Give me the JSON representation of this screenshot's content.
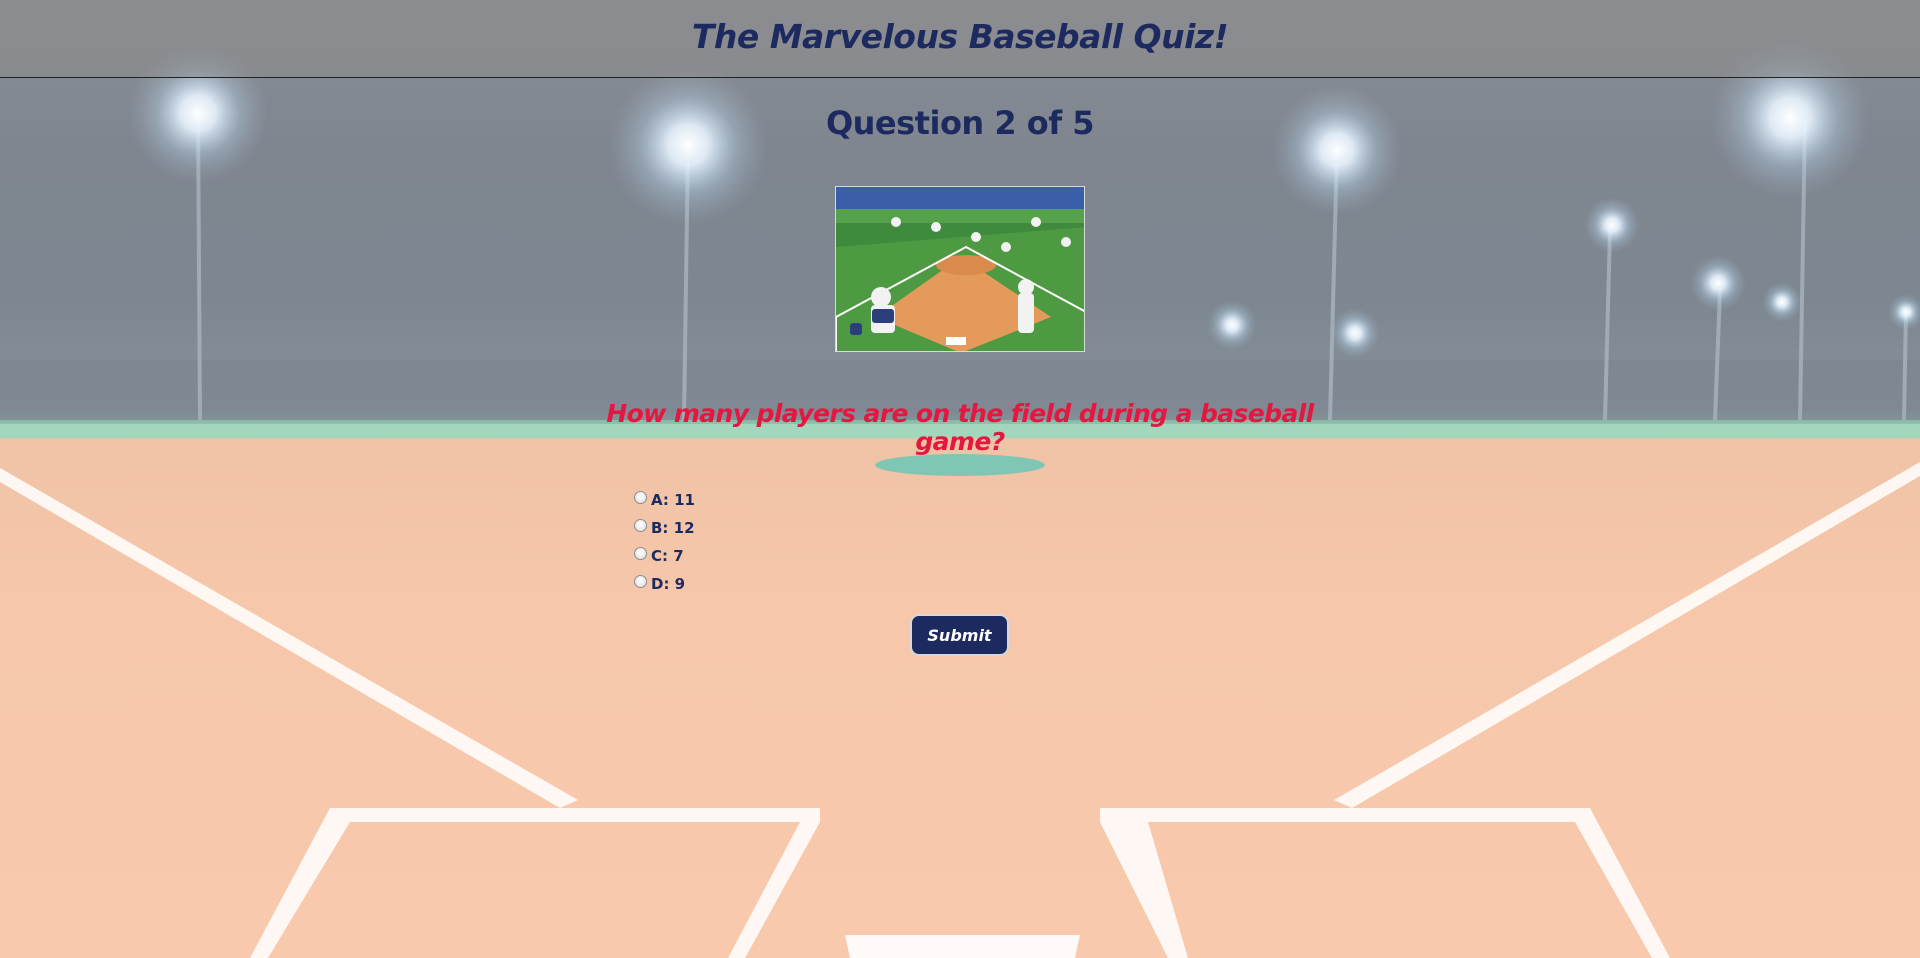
{
  "header": {
    "title": "The Marvelous Baseball Quiz!"
  },
  "quiz": {
    "counter": "Question 2 of 5",
    "image_alt": "baseball players on field",
    "question": "How many players are on the field during a baseball game?",
    "options": [
      {
        "label": "A: 11",
        "selected": false
      },
      {
        "label": "B: 12",
        "selected": false
      },
      {
        "label": "C: 7",
        "selected": false
      },
      {
        "label": "D: 9",
        "selected": false
      }
    ],
    "submit_label": "Submit"
  },
  "colors": {
    "navy": "#1c2a5f",
    "question_red": "#e3173f",
    "infield": "#f6c7aa",
    "grass": "#9ed3b8"
  }
}
